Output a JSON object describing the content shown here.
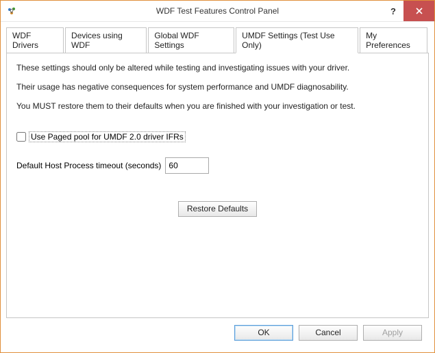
{
  "window": {
    "title": "WDF Test Features Control Panel"
  },
  "tabs": [
    {
      "label": "WDF Drivers"
    },
    {
      "label": "Devices using WDF"
    },
    {
      "label": "Global WDF Settings"
    },
    {
      "label": "UMDF Settings (Test Use Only)"
    },
    {
      "label": "My Preferences"
    }
  ],
  "panel": {
    "line1": "These settings should only be altered while testing and investigating issues with your driver.",
    "line2": "Their usage has negative consequences for system performance and UMDF diagnosability.",
    "line3": "You MUST restore them to their defaults when you are finished with your investigation or test.",
    "paged_pool_label": "Use Paged pool for UMDF 2.0 driver IFRs",
    "paged_pool_checked": false,
    "timeout_label": "Default Host Process timeout (seconds)",
    "timeout_value": "60",
    "restore_label": "Restore Defaults"
  },
  "footer": {
    "ok": "OK",
    "cancel": "Cancel",
    "apply": "Apply"
  }
}
